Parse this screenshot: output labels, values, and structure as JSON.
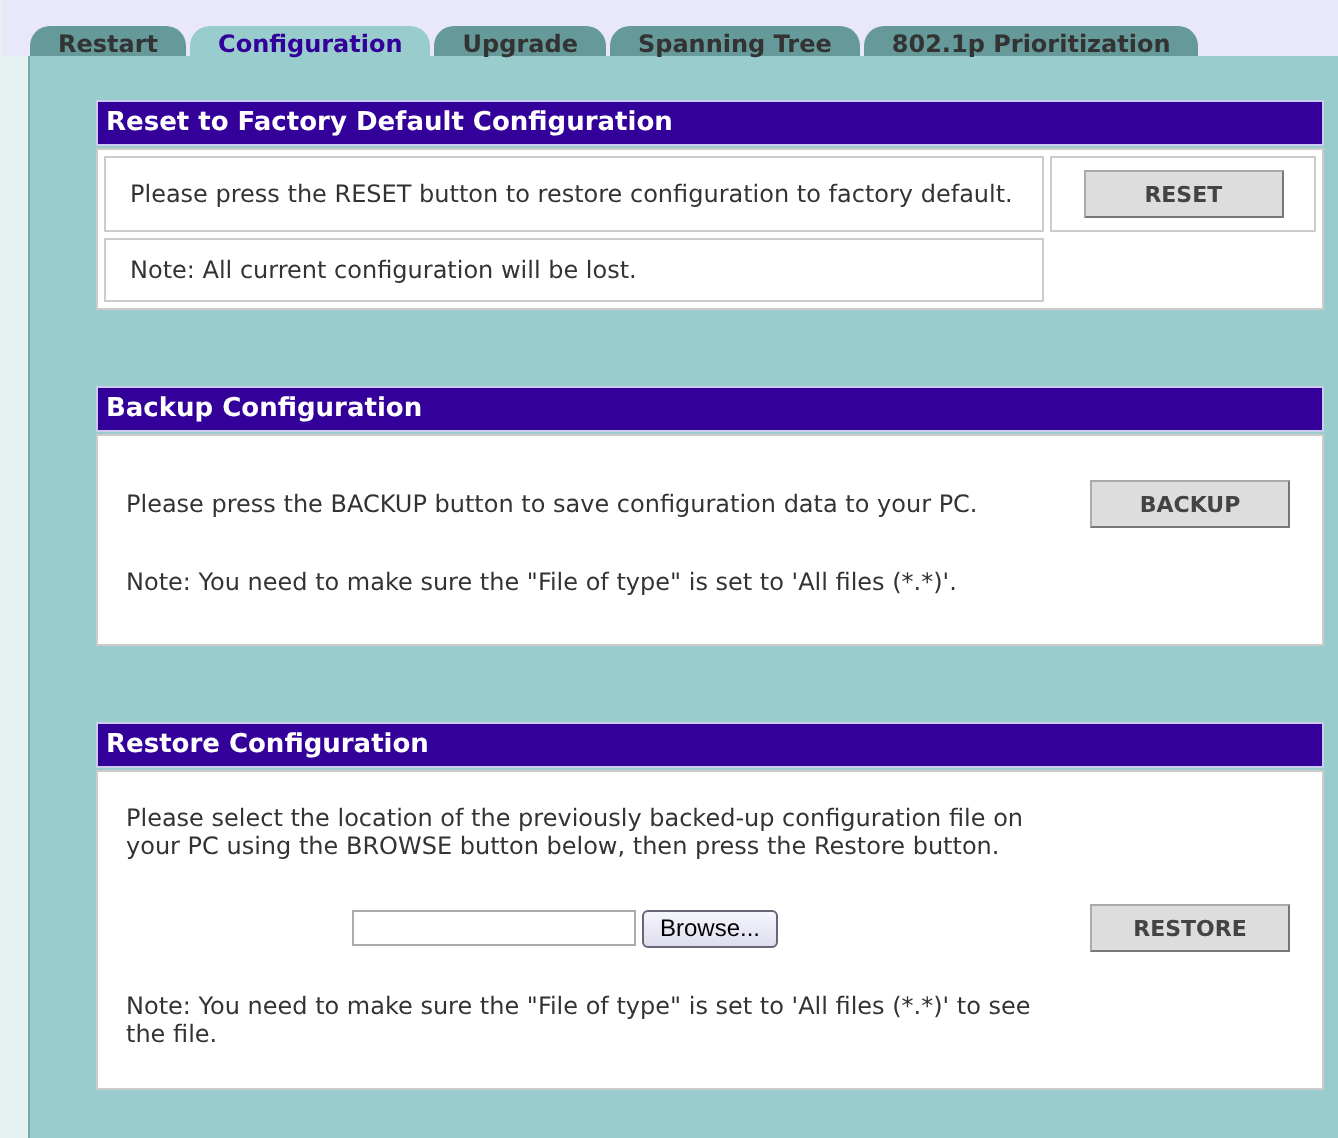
{
  "tabs": [
    {
      "label": "Restart",
      "selected": false
    },
    {
      "label": "Configuration",
      "selected": true
    },
    {
      "label": "Upgrade",
      "selected": false
    },
    {
      "label": "Spanning Tree",
      "selected": false
    },
    {
      "label": "802.1p Prioritization",
      "selected": false
    }
  ],
  "sections": [
    {
      "kind": "reset",
      "title": "Reset to Factory Default Configuration",
      "text": "Please press the RESET button to restore configuration to factory default.",
      "note": "Note: All current configuration will be lost.",
      "button": "RESET"
    },
    {
      "kind": "backup",
      "title": "Backup Configuration",
      "text": "Please press the BACKUP button to save configuration data to your PC.",
      "note": "Note: You need to make sure the \"File of type\" is set to 'All files (*.*)'.",
      "button": "BACKUP"
    },
    {
      "kind": "restore",
      "title": "Restore Configuration",
      "text": "Please select the location of the previously backed-up configuration file on your PC using the BROWSE button below, then press the Restore button.",
      "browse": "Browse...",
      "button": "RESTORE",
      "note": "Note: You need to make sure the \"File of type\" is set to 'All files (*.*)' to see the file."
    }
  ]
}
